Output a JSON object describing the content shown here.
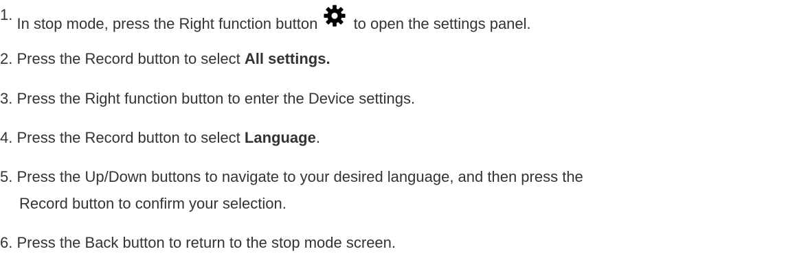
{
  "steps": [
    {
      "number": "1.",
      "before": "In stop mode, press the Right function button",
      "icon": "gear-icon",
      "after": "to open the settings panel."
    },
    {
      "number": "2.",
      "before": "Press the Record button to select",
      "bold": "All settings.",
      "after": ""
    },
    {
      "number": "3.",
      "before": "Press the Right function button to enter the Device settings.",
      "bold": "",
      "after": ""
    },
    {
      "number": "4.",
      "before": "Press the Record button to select",
      "bold": "Language",
      "after": "."
    },
    {
      "number": "5.",
      "before": "Press the Up/Down buttons to navigate to your desired language, and then press the",
      "continuation": "Record button to confirm your selection."
    },
    {
      "number": "6.",
      "before": "Press the Back button to return to the stop mode screen."
    }
  ],
  "colors": {
    "text": "#333333",
    "icon": "#000000"
  }
}
